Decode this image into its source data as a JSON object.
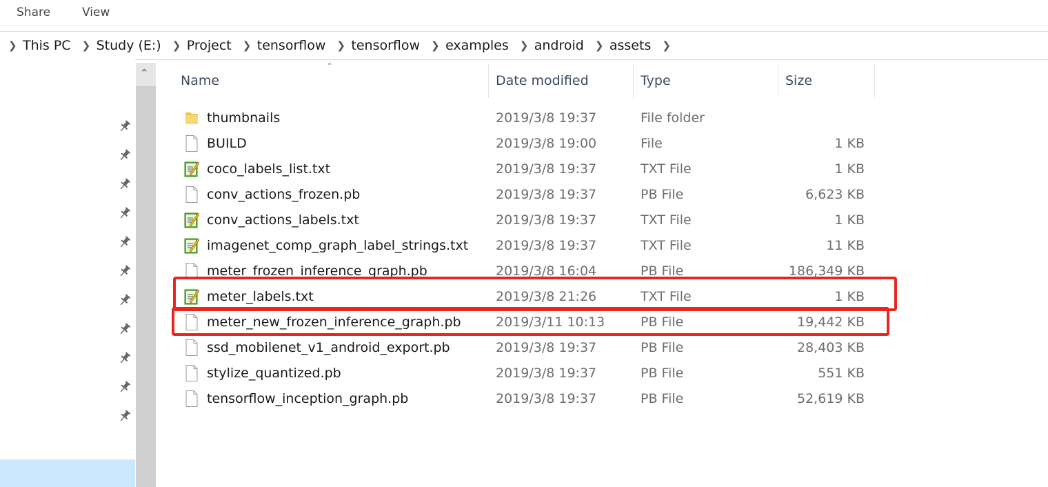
{
  "ribbon": {
    "tabs": [
      "Share",
      "View"
    ]
  },
  "breadcrumb": [
    "This PC",
    "Study (E:)",
    "Project",
    "tensorflow",
    "tensorflow",
    "examples",
    "android",
    "assets"
  ],
  "columns": {
    "name": "Name",
    "date": "Date modified",
    "type": "Type",
    "size": "Size"
  },
  "files": [
    {
      "name": "thumbnails",
      "date": "2019/3/8 19:37",
      "type": "File folder",
      "size": "",
      "icon": "folder-icon"
    },
    {
      "name": "BUILD",
      "date": "2019/3/8 19:00",
      "type": "File",
      "size": "1 KB",
      "icon": "file-icon"
    },
    {
      "name": "coco_labels_list.txt",
      "date": "2019/3/8 19:37",
      "type": "TXT File",
      "size": "1 KB",
      "icon": "text-file-icon"
    },
    {
      "name": "conv_actions_frozen.pb",
      "date": "2019/3/8 19:37",
      "type": "PB File",
      "size": "6,623 KB",
      "icon": "file-icon"
    },
    {
      "name": "conv_actions_labels.txt",
      "date": "2019/3/8 19:37",
      "type": "TXT File",
      "size": "1 KB",
      "icon": "text-file-icon"
    },
    {
      "name": "imagenet_comp_graph_label_strings.txt",
      "date": "2019/3/8 19:37",
      "type": "TXT File",
      "size": "11 KB",
      "icon": "text-file-icon"
    },
    {
      "name": "meter_frozen_inference_graph.pb",
      "date": "2019/3/8 16:04",
      "type": "PB File",
      "size": "186,349 KB",
      "icon": "file-icon"
    },
    {
      "name": "meter_labels.txt",
      "date": "2019/3/8 21:26",
      "type": "TXT File",
      "size": "1 KB",
      "icon": "text-file-icon"
    },
    {
      "name": "meter_new_frozen_inference_graph.pb",
      "date": "2019/3/11 10:13",
      "type": "PB File",
      "size": "19,442 KB",
      "icon": "file-icon"
    },
    {
      "name": "ssd_mobilenet_v1_android_export.pb",
      "date": "2019/3/8 19:37",
      "type": "PB File",
      "size": "28,403 KB",
      "icon": "file-icon"
    },
    {
      "name": "stylize_quantized.pb",
      "date": "2019/3/8 19:37",
      "type": "PB File",
      "size": "551 KB",
      "icon": "file-icon"
    },
    {
      "name": "tensorflow_inception_graph.pb",
      "date": "2019/3/8 19:37",
      "type": "PB File",
      "size": "52,619 KB",
      "icon": "file-icon"
    }
  ],
  "highlight_color": "#e8261f",
  "selection_color": "#cce8ff"
}
